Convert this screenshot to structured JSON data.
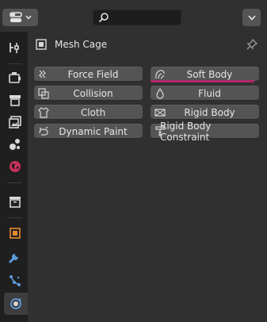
{
  "header": {
    "editor_type": "properties-editor-icon",
    "search_placeholder": ""
  },
  "sidebar": {
    "tabs": [
      {
        "name": "tool-tab",
        "icon": "tool-icon"
      },
      {
        "name": "render-tab",
        "icon": "render-icon"
      },
      {
        "name": "output-tab",
        "icon": "output-icon"
      },
      {
        "name": "view-layer-tab",
        "icon": "view-layer-icon"
      },
      {
        "name": "scene-tab",
        "icon": "scene-icon"
      },
      {
        "name": "world-tab",
        "icon": "world-icon"
      },
      {
        "name": "collection-tab",
        "icon": "collection-icon"
      },
      {
        "name": "object-tab",
        "icon": "object-icon"
      },
      {
        "name": "modifiers-tab",
        "icon": "wrench-icon"
      },
      {
        "name": "particles-tab",
        "icon": "particles-icon"
      },
      {
        "name": "physics-tab",
        "icon": "physics-icon",
        "active": true
      }
    ]
  },
  "context": {
    "object_name": "Mesh Cage"
  },
  "physics_buttons": {
    "force_field": "Force Field",
    "collision": "Collision",
    "cloth": "Cloth",
    "dynamic_paint": "Dynamic Paint",
    "soft_body": "Soft Body",
    "fluid": "Fluid",
    "rigid_body": "Rigid Body",
    "rigid_body_constraint": "Rigid Body Constraint"
  },
  "colors": {
    "accent_underline": "#b0276a",
    "button_bg": "#545454",
    "panel_bg": "#303030",
    "tab_bg": "#1f1f1f"
  }
}
